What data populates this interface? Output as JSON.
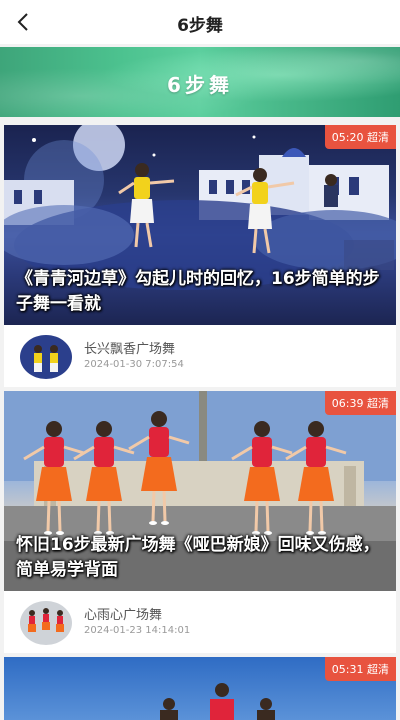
{
  "header": {
    "title": "6步舞"
  },
  "banner": {
    "title": "6步舞"
  },
  "videos": [
    {
      "duration_badge": "05:20 超清",
      "title": "《青青河边草》勾起儿时的回忆，16步简单的步子舞一看就",
      "author": "长兴飘香广场舞",
      "date": "2024-01-30 7:07:54"
    },
    {
      "duration_badge": "06:39 超清",
      "title": "怀旧16步最新广场舞《哑巴新娘》回味又伤感，简单易学背面",
      "author": "心雨心广场舞",
      "date": "2024-01-23 14:14:01"
    },
    {
      "duration_badge": "05:31 超清"
    }
  ],
  "colors": {
    "badge": "#e8533f",
    "banner": "#4cc28f",
    "shirt_yellow": "#f2d21c",
    "shirt_red": "#e0243a"
  }
}
